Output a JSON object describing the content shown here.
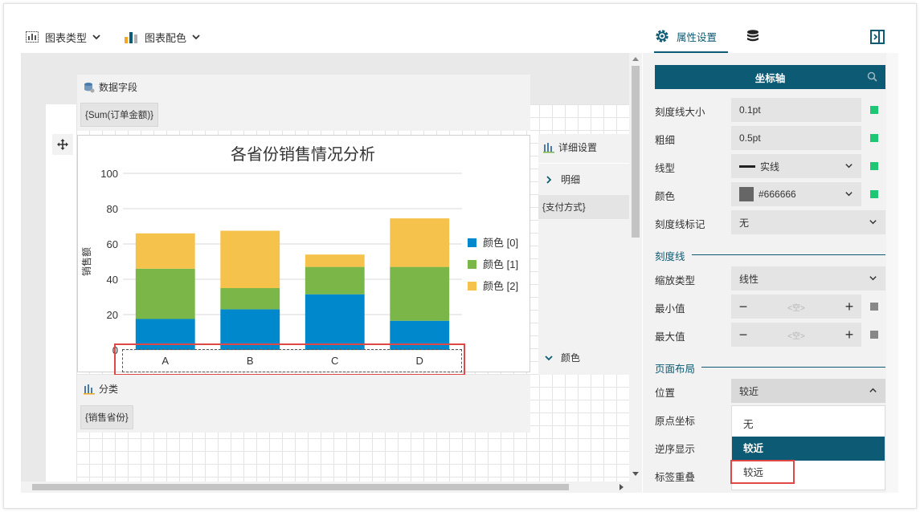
{
  "toolbar": {
    "chart_type_label": "图表类型",
    "chart_color_label": "图表配色"
  },
  "zones": {
    "data_field": {
      "title": "数据字段",
      "chip": "{Sum(订单金额)}"
    },
    "category": {
      "title": "分类",
      "chip": "{销售省份}"
    },
    "details": {
      "title": "详细设置",
      "item": "明细",
      "chip": "{支付方式}",
      "color_item": "颜色"
    }
  },
  "chart_data": {
    "type": "bar",
    "stacked": true,
    "title": "各省份销售情况分析",
    "ylabel": "销售额",
    "xlabel": "",
    "ylim": [
      0,
      100
    ],
    "yticks": [
      0,
      20,
      40,
      60,
      80,
      100
    ],
    "categories": [
      "A",
      "B",
      "C",
      "D"
    ],
    "series": [
      {
        "name": "颜色 [0]",
        "color": "#0088cc",
        "values": [
          17.5,
          23,
          31.5,
          16.5
        ]
      },
      {
        "name": "颜色 [1]",
        "color": "#7ab648",
        "values": [
          28.5,
          12,
          15.5,
          30.5
        ]
      },
      {
        "name": "颜色 [2]",
        "color": "#f5c24c",
        "values": [
          20,
          32.5,
          7,
          27.5
        ]
      }
    ],
    "legend": "right",
    "grid": true
  },
  "panel": {
    "tab_properties": "属性设置",
    "search_title": "坐标轴",
    "rows": {
      "tick_size": {
        "label": "刻度线大小",
        "value": "0.1pt"
      },
      "thickness": {
        "label": "粗细",
        "value": "0.5pt"
      },
      "line_type": {
        "label": "线型",
        "value": "实线"
      },
      "color": {
        "label": "颜色",
        "value": "#666666"
      },
      "tick_mark": {
        "label": "刻度线标记",
        "value": "无"
      },
      "scale_type": {
        "label": "缩放类型",
        "value": "线性"
      },
      "min": {
        "label": "最小值",
        "placeholder": "<空>"
      },
      "max": {
        "label": "最大值",
        "placeholder": "<空>"
      },
      "position": {
        "label": "位置",
        "value": "较近"
      },
      "origin": {
        "label": "原点坐标"
      },
      "reverse": {
        "label": "逆序显示"
      },
      "overlap": {
        "label": "标签重叠"
      }
    },
    "sections": {
      "ticks": "刻度线",
      "layout": "页面布局"
    },
    "position_options": [
      "无",
      "较近",
      "较远"
    ],
    "accent_color": "#0c5a73",
    "status_green": "#1ec773",
    "status_gray": "#888888"
  }
}
